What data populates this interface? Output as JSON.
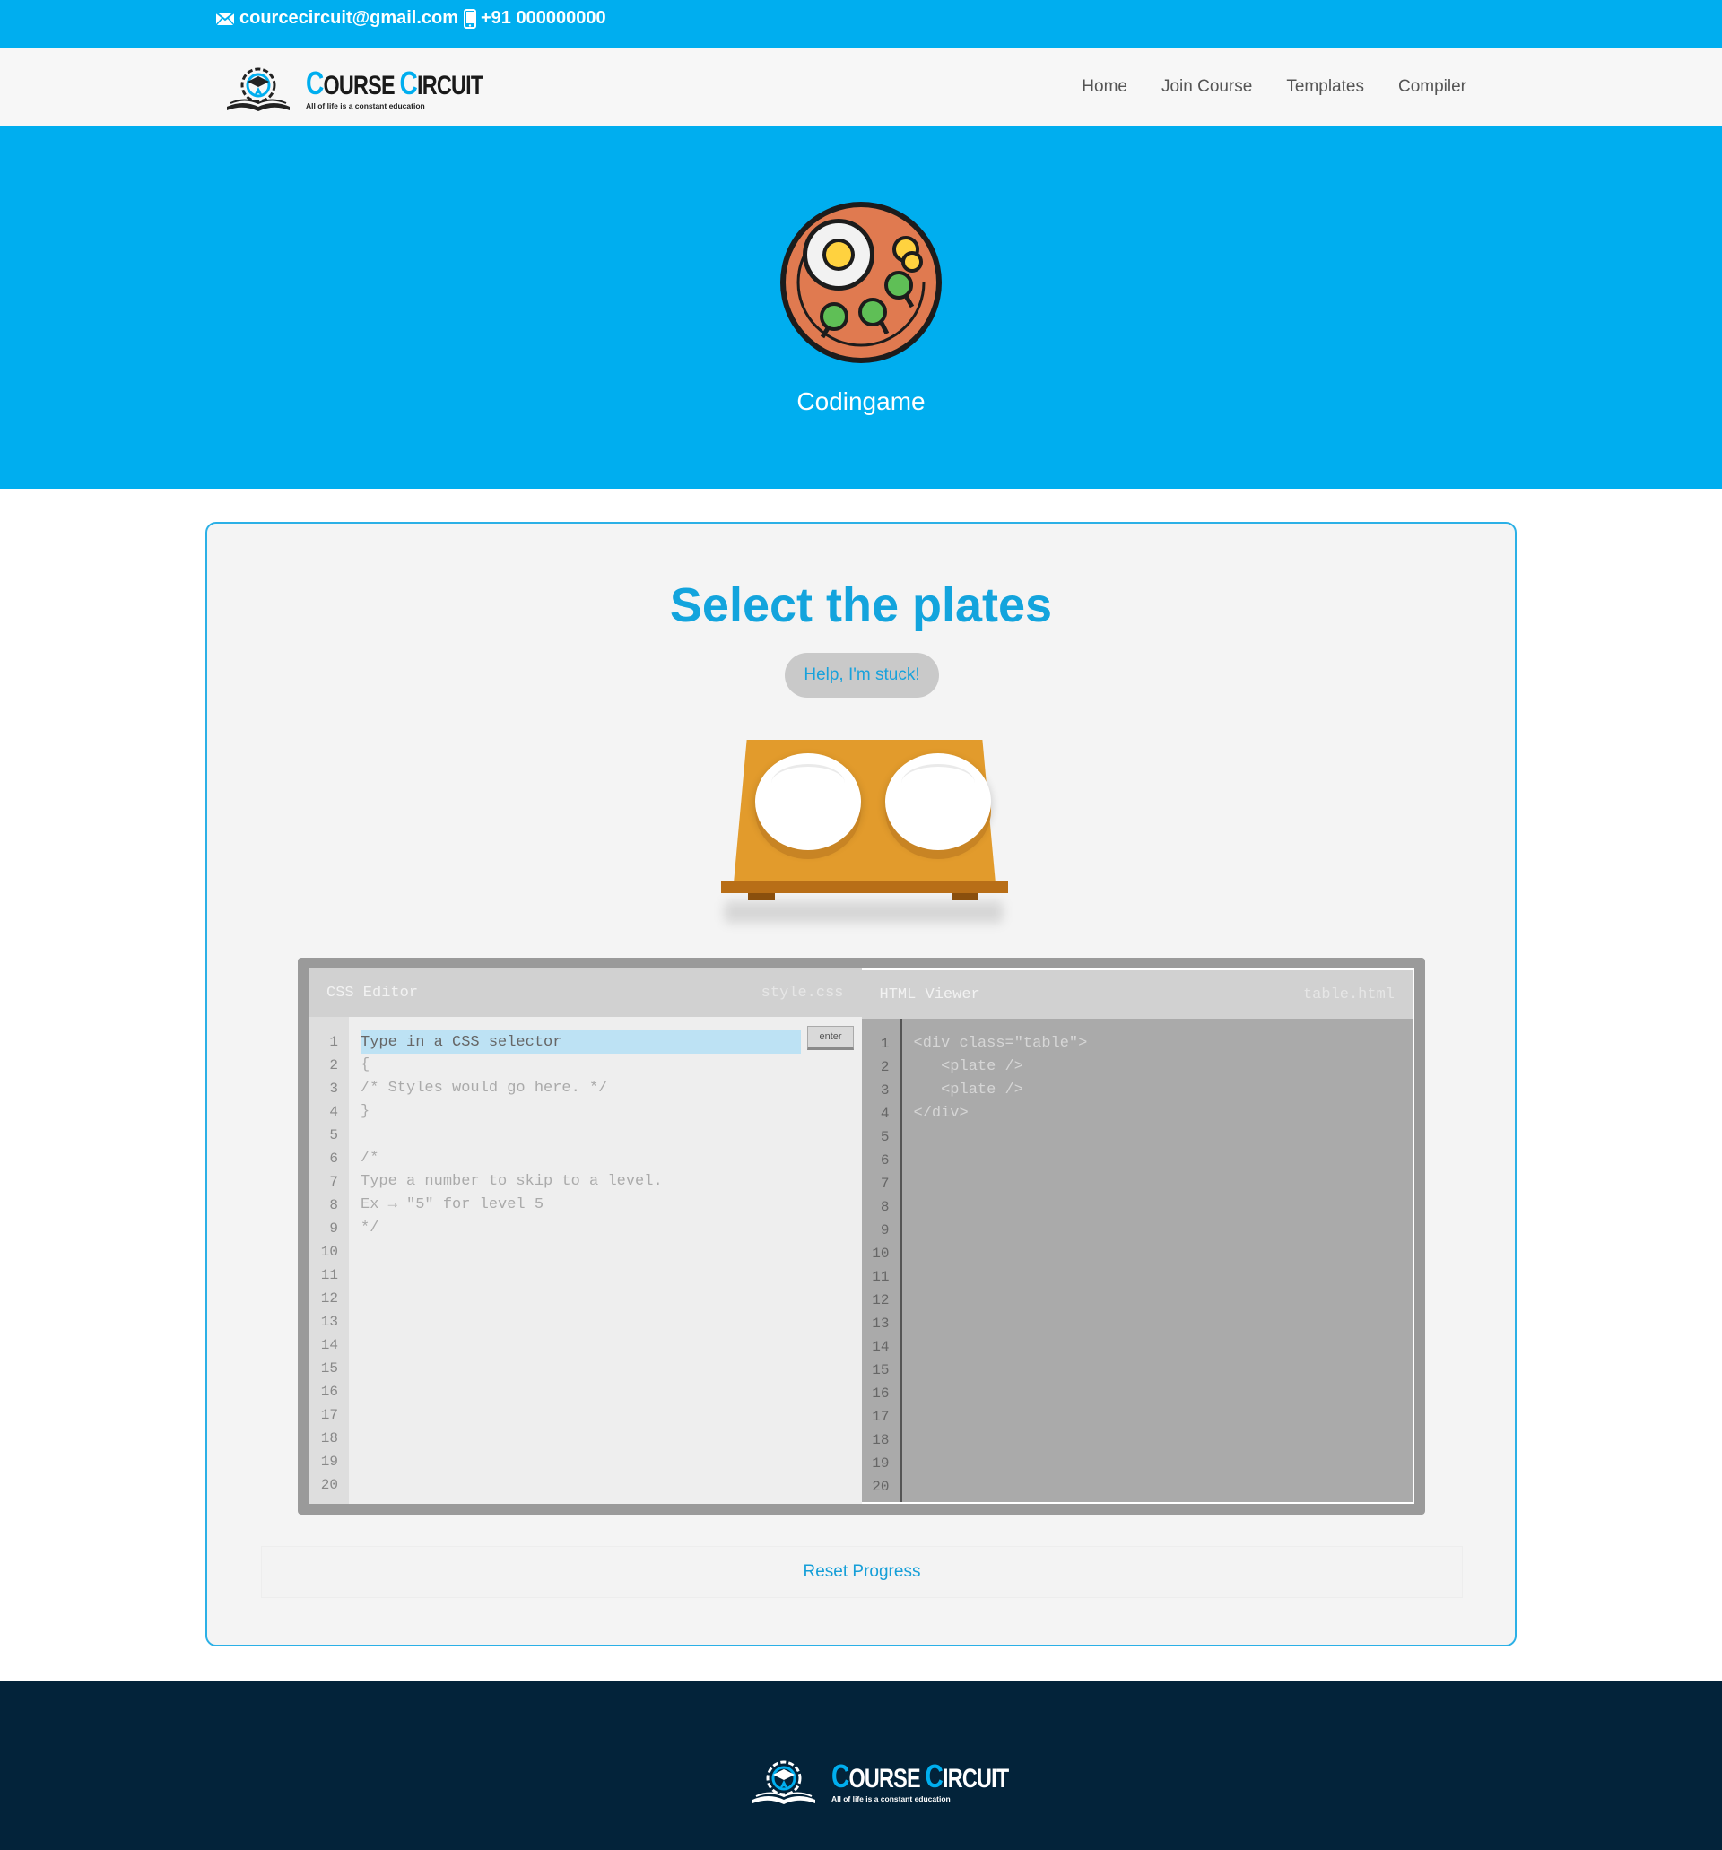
{
  "topbar": {
    "email": "courcecircuit@gmail.com",
    "phone": "+91 000000000"
  },
  "logo": {
    "title_c1": "C",
    "title_rest1": "OURSE ",
    "title_c2": "C",
    "title_rest2": "IRCUIT",
    "tagline": "All of life is a constant education"
  },
  "nav": {
    "items": [
      {
        "label": "Home"
      },
      {
        "label": "Join Course"
      },
      {
        "label": "Templates"
      },
      {
        "label": "Compiler"
      }
    ]
  },
  "hero": {
    "title": "Codingame"
  },
  "game": {
    "level_title": "Select the plates",
    "help_label": "Help, I'm stuck!",
    "css_editor": {
      "title": "CSS Editor",
      "filename": "style.css",
      "input_placeholder": "Type in a CSS selector",
      "enter_label": "enter",
      "lines": [
        "{",
        "/* Styles would go here. */",
        "}",
        "",
        "/*",
        "Type a number to skip to a level.",
        "Ex → \"5\" for level 5",
        "*/"
      ]
    },
    "html_viewer": {
      "title": "HTML Viewer",
      "filename": "table.html",
      "lines": [
        "<div class=\"table\">",
        "   <plate />",
        "   <plate />",
        "</div>"
      ]
    },
    "line_numbers": [
      "1",
      "2",
      "3",
      "4",
      "5",
      "6",
      "7",
      "8",
      "9",
      "10",
      "11",
      "12",
      "13",
      "14",
      "15",
      "16",
      "17",
      "18",
      "19",
      "20"
    ],
    "reset_label": "Reset Progress"
  },
  "colors": {
    "brand_blue": "#00aeef",
    "footer_navy": "#03233a",
    "title_blue": "#13a4dd",
    "table_wood": "#e29b2c"
  }
}
